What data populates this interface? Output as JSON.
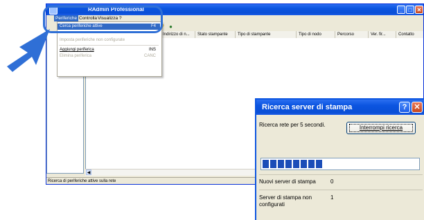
{
  "window": {
    "title": "...BRAdmin Professional",
    "title_visible_suffix": "RAdmin Professional",
    "minimize_glyph": "_",
    "maximize_glyph": "□",
    "close_glyph": "✕"
  },
  "menubar": {
    "items": [
      {
        "label": "Periferiche"
      },
      {
        "label": "Controlla"
      },
      {
        "label": "Visualizza"
      },
      {
        "label": "?"
      }
    ]
  },
  "toolbar": {
    "icons": [
      "refresh-icon",
      "help-icon",
      "network-icon"
    ]
  },
  "columns": [
    "Indirizzo di n...",
    "Stato stampante",
    "Tipo di stampante",
    "Tipo di nodo",
    "Percorso",
    "Ver. fir...",
    "Contatto"
  ],
  "dropdown": {
    "items": [
      {
        "label": "Cerca periferiche attive",
        "shortcut": "F4",
        "state": "selected"
      },
      {
        "label": "Imposta periferiche non configurate",
        "shortcut": "",
        "state": "disabled"
      },
      {
        "label": "Aggiungi periferica",
        "shortcut": "INS",
        "state": "normal"
      },
      {
        "label": "Elimina periferica",
        "shortcut": "CANC",
        "state": "disabled"
      }
    ]
  },
  "statusbar": {
    "text": "Ricerca di periferiche attive sulla rete"
  },
  "dialog": {
    "title": "Ricerca server di stampa",
    "help_glyph": "?",
    "close_glyph": "✕",
    "message": "Ricerca rete per 5 secondi.",
    "stop_button": "Interrompi ricerca",
    "progress_blocks": 8,
    "new_servers_label": "Nuovi server di stampa",
    "new_servers_value": "0",
    "unconfigured_label_line1": "Server di stampa non",
    "unconfigured_label_line2": "configurati",
    "unconfigured_value": "1"
  },
  "colors": {
    "title_blue": "#0b54e0",
    "selection_blue": "#316ac5",
    "highlight_outline": "#2f6fd6",
    "progress_block": "#1b4db8",
    "window_face": "#ece9d8"
  }
}
